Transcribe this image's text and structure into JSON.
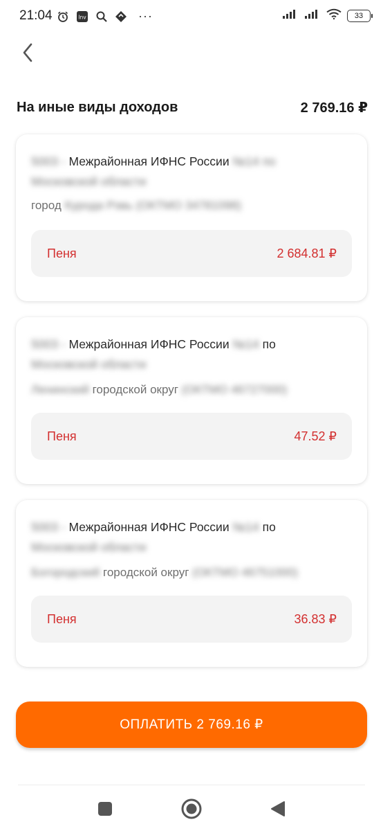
{
  "status_bar": {
    "time": "21:04",
    "battery": "33",
    "icons_left": [
      "alarm-icon",
      "app-notification-icon",
      "search-icon",
      "app-icon"
    ],
    "more": "···"
  },
  "section": {
    "title": "На иные виды доходов",
    "total": "2 769.16 ₽"
  },
  "cards": [
    {
      "org_blur_prefix": "5003 -",
      "org_text": "Межрайонная ИФНС России",
      "org_blur_suffix": "№14 по",
      "org_blur_line2": "Московской области",
      "loc_prefix": "город",
      "loc_blur": "Курода Рэвь (ОКТМО 34781098)",
      "loc_suffix": "",
      "fee_label": "Пеня",
      "fee_amount": "2 684.81 ₽"
    },
    {
      "org_blur_prefix": "5003 -",
      "org_text": "Межрайонная ИФНС России",
      "org_blur_suffix": "№14",
      "org_tail": "по",
      "org_blur_line2": "Московской области",
      "loc_blur_pre": "Ленинский",
      "loc_text": "городской округ",
      "loc_blur": "(ОКТМО 46727000)",
      "fee_label": "Пеня",
      "fee_amount": "47.52 ₽"
    },
    {
      "org_blur_prefix": "5003 -",
      "org_text": "Межрайонная ИФНС России",
      "org_blur_suffix": "№14",
      "org_tail": "по",
      "org_blur_line2": "Московской области",
      "loc_blur_pre": "Богородский",
      "loc_text": "городской округ",
      "loc_blur": "(ОКТМО 46751000)",
      "fee_label": "Пеня",
      "fee_amount": "36.83 ₽"
    }
  ],
  "pay_button": {
    "label": "ОПЛАТИТЬ 2 769.16 ₽"
  },
  "colors": {
    "accent": "#ff6a00",
    "fee_text": "#d32f2f",
    "fee_bg": "#f3f3f3"
  }
}
